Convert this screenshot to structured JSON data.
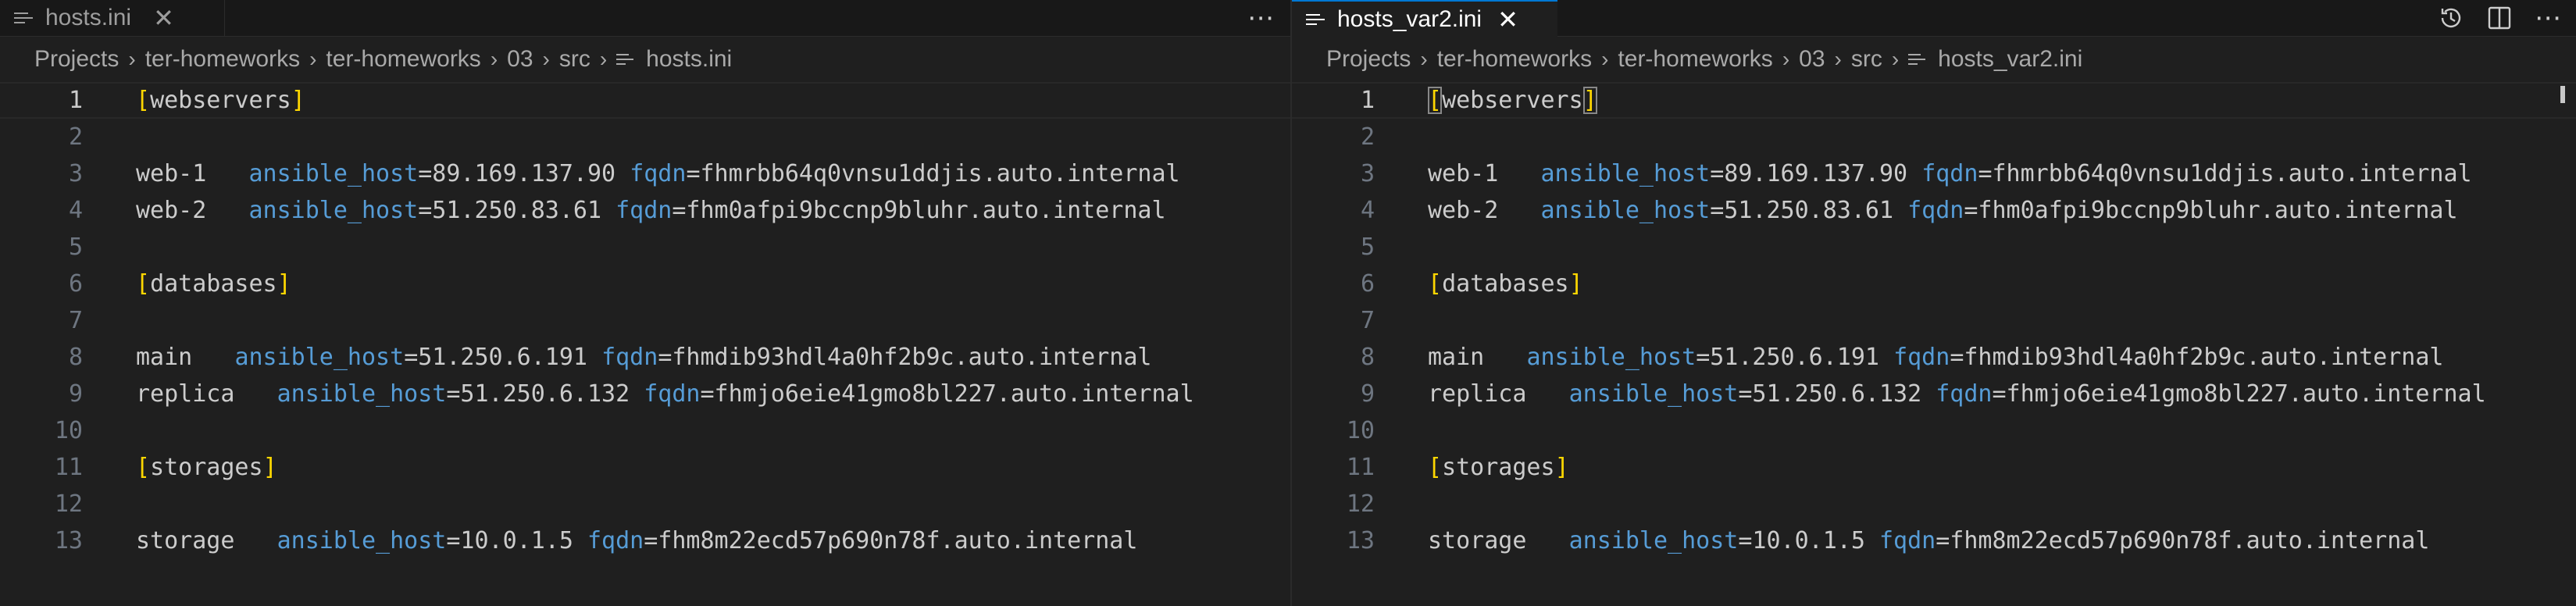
{
  "left": {
    "tab": {
      "label": "hosts.ini",
      "close": "✕"
    },
    "breadcrumb": [
      "Projects",
      "ter-homeworks",
      "ter-homeworks",
      "03",
      "src",
      "hosts.ini"
    ]
  },
  "right": {
    "tab": {
      "label": "hosts_var2.ini",
      "close": "✕"
    },
    "breadcrumb": [
      "Projects",
      "ter-homeworks",
      "ter-homeworks",
      "03",
      "src",
      "hosts_var2.ini"
    ]
  },
  "icons": {
    "more": "⋯",
    "split": "split-editor-icon",
    "timeline": "open-changes-icon",
    "chevron": "›"
  },
  "code": {
    "line_numbers": [
      "1",
      "2",
      "3",
      "4",
      "5",
      "6",
      "7",
      "8",
      "9",
      "10",
      "11",
      "12",
      "13"
    ],
    "sections": {
      "webservers": "webservers",
      "databases": "databases",
      "storages": "storages"
    },
    "hosts": [
      {
        "name": "web-1",
        "pad": "   ",
        "key1": "ansible_host",
        "val1": "=89.169.137.90 ",
        "key2": "fqdn",
        "val2": "=fhmrbb64q0vnsu1ddjis.auto.internal"
      },
      {
        "name": "web-2",
        "pad": "   ",
        "key1": "ansible_host",
        "val1": "=51.250.83.61 ",
        "key2": "fqdn",
        "val2": "=fhm0afpi9bccnp9bluhr.auto.internal"
      },
      {
        "name": "main",
        "pad": "   ",
        "key1": "ansible_host",
        "val1": "=51.250.6.191 ",
        "key2": "fqdn",
        "val2": "=fhmdib93hdl4a0hf2b9c.auto.internal"
      },
      {
        "name": "replica",
        "pad": "   ",
        "key1": "ansible_host",
        "val1": "=51.250.6.132 ",
        "key2": "fqdn",
        "val2": "=fhmjo6eie41gmo8bl227.auto.internal"
      },
      {
        "name": "storage",
        "pad": "   ",
        "key1": "ansible_host",
        "val1": "=10.0.1.5 ",
        "key2": "fqdn",
        "val2": "=fhm8m22ecd57p690n78f.auto.internal"
      }
    ],
    "brackets": {
      "open": "[",
      "close": "]"
    }
  },
  "colors": {
    "key": "#569cd6",
    "bracket": "#ffd700",
    "text": "#cccccc",
    "accent": "#0078d4"
  }
}
